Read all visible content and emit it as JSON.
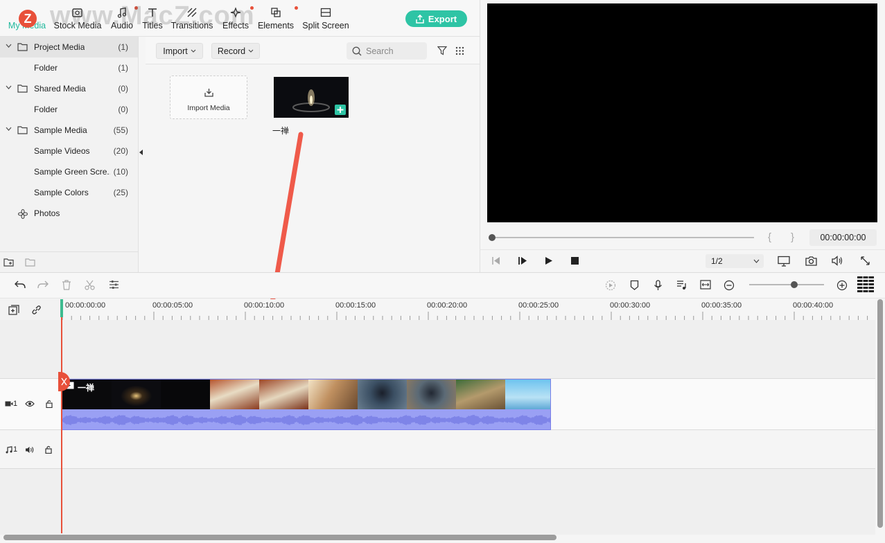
{
  "watermark": "www.MacZ.com",
  "logo_letter": "Z",
  "top_tabs": [
    {
      "label": "My Media",
      "icon": "folder-icon",
      "active": true
    },
    {
      "label": "Stock Media",
      "icon": "stock-media-icon"
    },
    {
      "label": "Audio",
      "icon": "music-note-icon"
    },
    {
      "label": "Titles",
      "icon": "text-icon"
    },
    {
      "label": "Transitions",
      "icon": "transition-icon"
    },
    {
      "label": "Effects",
      "icon": "effects-icon"
    },
    {
      "label": "Elements",
      "icon": "elements-icon"
    },
    {
      "label": "Split Screen",
      "icon": "split-screen-icon"
    }
  ],
  "export_label": "Export",
  "sidebar": {
    "items": [
      {
        "name": "Project Media",
        "count": "(1)",
        "folder": true
      },
      {
        "name": "Folder",
        "count": "(1)"
      },
      {
        "name": "Shared Media",
        "count": "(0)",
        "folder": true
      },
      {
        "name": "Folder",
        "count": "(0)"
      },
      {
        "name": "Sample Media",
        "count": "(55)",
        "folder": true
      },
      {
        "name": "Sample Videos",
        "count": "(20)"
      },
      {
        "name": "Sample Green Scre...",
        "count": "(10)"
      },
      {
        "name": "Sample Colors",
        "count": "(25)"
      },
      {
        "name": "Photos",
        "count": ""
      }
    ]
  },
  "media_toolbar": {
    "import_label": "Import",
    "record_label": "Record",
    "search_placeholder": "Search"
  },
  "media": {
    "import_tile_label": "Import Media",
    "clip_name": "一禅"
  },
  "preview": {
    "timecode": "00:00:00:00",
    "ratio": "1/2",
    "brace_open": "{",
    "brace_close": "}"
  },
  "timeline": {
    "ticks": [
      "00:00:00:00",
      "00:00:05:00",
      "00:00:10:00",
      "00:00:15:00",
      "00:00:20:00",
      "00:00:25:00",
      "00:00:30:00",
      "00:00:35:00",
      "00:00:40:00"
    ],
    "clip_title": "一禅",
    "video_track_label": "1",
    "audio_track_label": "1",
    "zoom_level": 0.6
  },
  "colors": {
    "accent": "#2ec4a5",
    "playhead": "#e8503a",
    "clip": "#8f95f0",
    "annotation_arrow": "#ef5a4a"
  }
}
